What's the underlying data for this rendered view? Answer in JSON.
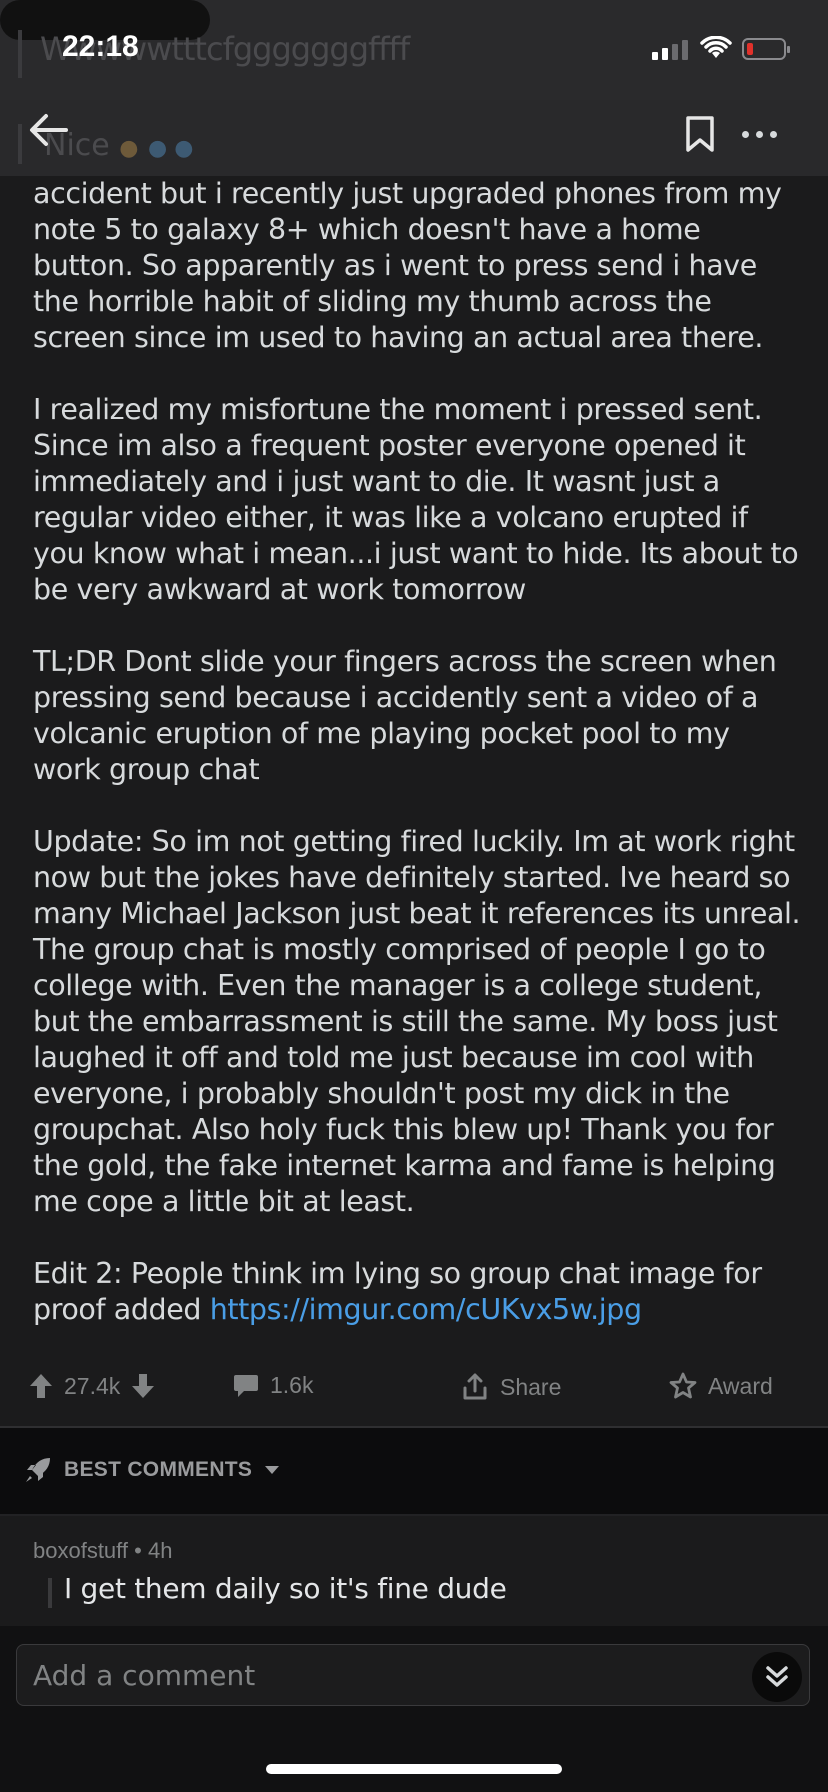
{
  "status_bar": {
    "time": "22:18",
    "ghost_text_top": "Wwwwwtttcfgggggggffff",
    "ghost_text_second": "Nice"
  },
  "nav": {
    "back_icon": "arrow-left-icon",
    "bookmark_icon": "bookmark-icon",
    "more_icon": "more-horizontal-icon"
  },
  "post": {
    "paragraphs": [
      "accident but i recently  just upgraded phones from my note 5 to galaxy 8+ which doesn't have a home button. So apparently as i went to press send i have the horrible habit of sliding my thumb across the screen since im used to having an actual area there.",
      "I realized my misfortune the moment i pressed sent. Since im also a frequent poster everyone opened it immediately and i just want to die. It wasnt just a regular video either, it was like a volcano erupted if you know what i mean...i just want to hide. Its about to be very awkward at work tomorrow",
      "TL;DR Dont slide your fingers across the screen when pressing send  because i accidently sent a video of a volcanic eruption of me playing pocket pool to my work group chat",
      "Update: So im not getting fired luckily. Im at work right now but the jokes have definitely started. Ive heard so many Michael Jackson just beat it references its unreal. The group chat is mostly comprised of people I go to college with. Even the manager is a college student, but the embarrassment is still the same. My boss just laughed it off and told me just because im cool with everyone, i probably shouldn't post my dick in the groupchat.  Also holy fuck this blew up! Thank you for the gold, the fake internet karma and fame is helping me cope a little bit at least."
    ],
    "edit_text": "Edit 2: People think im lying so group chat image for proof added ",
    "edit_link": "https://imgur.com/cUKvx5w.jpg"
  },
  "actions": {
    "upvotes": "27.4k",
    "comments": "1.6k",
    "share": "Share",
    "award": "Award"
  },
  "comments": {
    "sort_label": "BEST COMMENTS",
    "items": [
      {
        "author": "boxofstuff",
        "age": "4h",
        "text": "I get them daily so it's fine dude"
      }
    ],
    "input_placeholder": "Add a comment"
  },
  "colors": {
    "background": "#1b1b1c",
    "link": "#4a9ee6",
    "muted": "#818384",
    "battery_low": "#e0312b"
  }
}
